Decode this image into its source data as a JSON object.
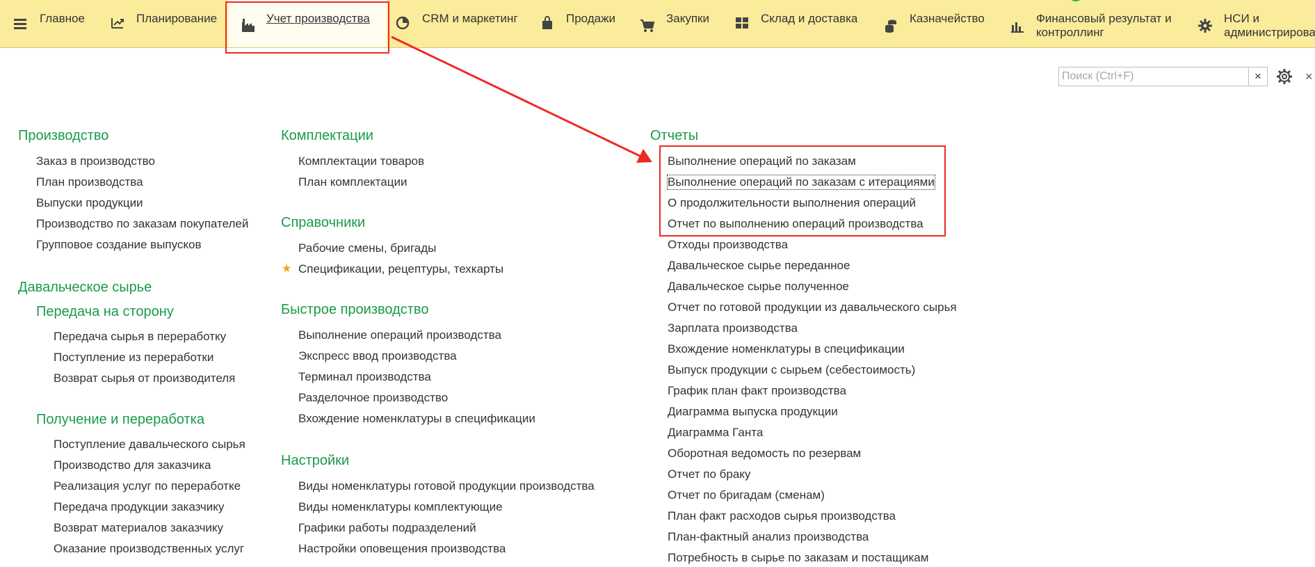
{
  "nav": {
    "items": [
      {
        "label": "Главное"
      },
      {
        "label": "Планирование"
      },
      {
        "label": "Учет производства"
      },
      {
        "label": "CRM и маркетинг"
      },
      {
        "label": "Продажи"
      },
      {
        "label": "Закупки"
      },
      {
        "label": "Склад и доставка"
      },
      {
        "label": "Казначейство"
      },
      {
        "label": "Финансовый результат и контроллинг"
      },
      {
        "label": "НСИ и администрирование"
      }
    ],
    "active": "Учет производства"
  },
  "search": {
    "placeholder": "Поиск (Ctrl+F)",
    "clear_label": "×",
    "close_label": "×"
  },
  "columns": {
    "col1": {
      "production": {
        "title": "Производство",
        "items": [
          "Заказ в производство",
          "План производства",
          "Выпуски продукции",
          "Производство по заказам покупателей",
          "Групповое создание выпусков"
        ]
      },
      "tolling": {
        "title": "Давальческое сырье",
        "transfer": {
          "title": "Передача на сторону",
          "items": [
            "Передача сырья в переработку",
            "Поступление из переработки",
            "Возврат сырья от производителя"
          ]
        },
        "receipt": {
          "title": "Получение и переработка",
          "items": [
            "Поступление давальческого сырья",
            "Производство для заказчика",
            "Реализация услуг по переработке",
            "Передача продукции заказчику",
            "Возврат материалов заказчику",
            "Оказание производственных услуг"
          ]
        }
      }
    },
    "col2": {
      "kits": {
        "title": "Комплектации",
        "items": [
          "Комплектации товаров",
          "План комплектации"
        ]
      },
      "refs": {
        "title": "Справочники",
        "items": [
          "Рабочие смены, бригады",
          "Спецификации, рецептуры, техкарты"
        ]
      },
      "quick": {
        "title": "Быстрое производство",
        "items": [
          "Выполнение операций производства",
          "Экспресс ввод производства",
          "Терминал производства",
          "Разделочное производство",
          "Вхождение номенклатуры в спецификации"
        ]
      },
      "settings": {
        "title": "Настройки",
        "items": [
          "Виды номенклатуры готовой продукции производства",
          "Виды номенклатуры комплектующие",
          "Графики работы подразделений",
          "Настройки оповещения производства"
        ]
      }
    },
    "col3": {
      "reports": {
        "title": "Отчеты",
        "items": [
          "Выполнение операций по заказам",
          "Выполнение операций по заказам с итерациями",
          "О продолжительности выполнения операций",
          "Отчет по выполнению операций производства",
          "Отходы производства",
          "Давальческое сырье переданное",
          "Давальческое сырье полученное",
          "Отчет по готовой продукции из давальческого сырья",
          "Зарплата производства",
          "Вхождение номенклатуры в спецификации",
          "Выпуск продукции с сырьем (себестоимость)",
          "График план факт производства",
          "Диаграмма выпуска продукции",
          "Диаграмма Ганта",
          "Оборотная ведомость по резервам",
          "Отчет по браку",
          "Отчет по бригадам (сменам)",
          "План факт расходов сырья производства",
          "План-фактный анализ производства",
          "Потребность в сырье по заказам и постащикам"
        ]
      }
    }
  },
  "colors": {
    "topbar": "#fbec9c",
    "section_title": "#1a9a4a",
    "annotation": "#ee2a24",
    "favorite_star": "#f2a215"
  }
}
